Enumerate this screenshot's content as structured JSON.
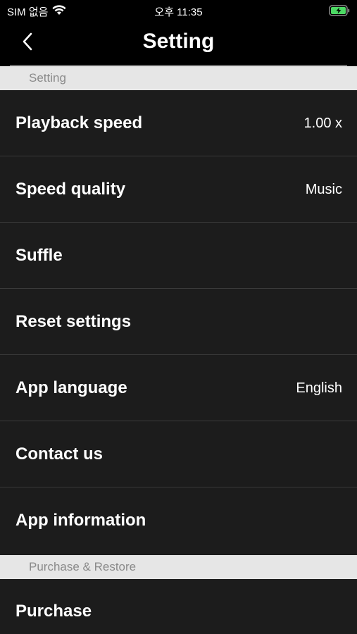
{
  "status_bar": {
    "carrier": "SIM 없음",
    "time": "오후 11:35",
    "wifi_icon": "wifi-icon",
    "battery_icon": "battery-charging-icon",
    "battery_color": "#4cd964"
  },
  "nav": {
    "title": "Setting",
    "back_icon": "chevron-left-icon"
  },
  "sections": {
    "setting": {
      "header": "Setting",
      "items": [
        {
          "label": "Playback speed",
          "value": "1.00 x"
        },
        {
          "label": "Speed quality",
          "value": "Music"
        },
        {
          "label": "Suffle",
          "value": ""
        },
        {
          "label": "Reset settings",
          "value": ""
        },
        {
          "label": "App language",
          "value": "English"
        },
        {
          "label": "Contact us",
          "value": ""
        },
        {
          "label": "App information",
          "value": ""
        }
      ]
    },
    "purchase": {
      "header": "Purchase & Restore",
      "items": [
        {
          "label": "Purchase",
          "value": ""
        }
      ]
    }
  },
  "colors": {
    "background": "#1c1c1c",
    "bar": "#000000",
    "section_header_bg": "#e6e6e6",
    "section_header_text": "#8a8a8a",
    "separator": "#3a3a3a"
  }
}
